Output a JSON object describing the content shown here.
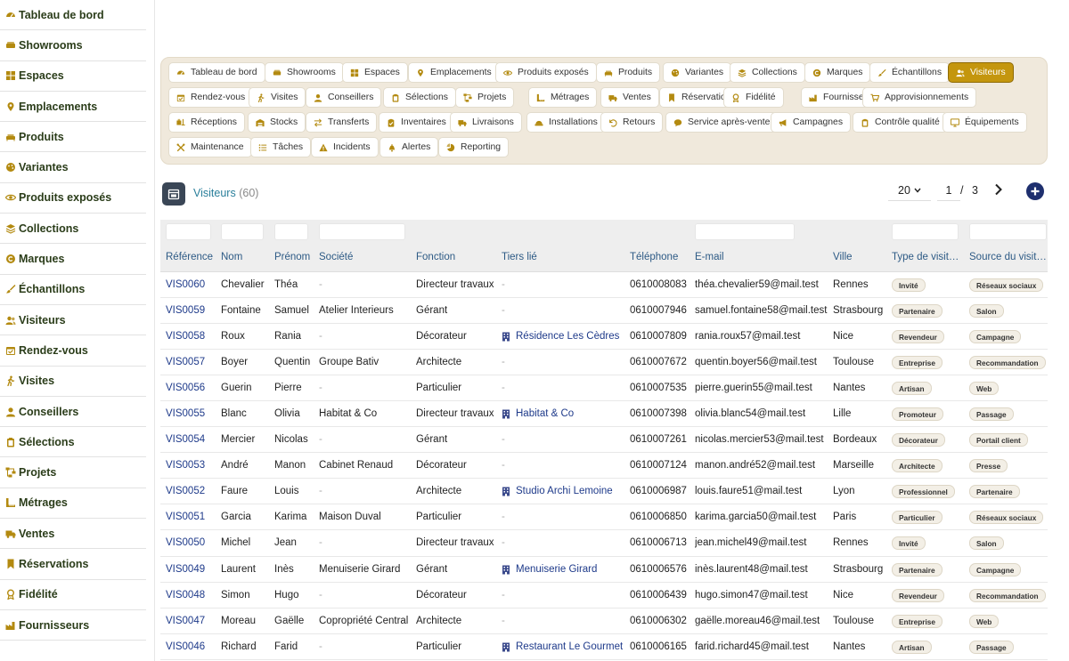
{
  "sidebar": {
    "items": [
      {
        "label": "Tableau de bord",
        "icon": "dashboard-icon"
      },
      {
        "label": "Showrooms",
        "icon": "sofa-icon"
      },
      {
        "label": "Espaces",
        "icon": "grid-icon"
      },
      {
        "label": "Emplacements",
        "icon": "pin-icon"
      },
      {
        "label": "Produits",
        "icon": "couch-icon"
      },
      {
        "label": "Variantes",
        "icon": "palette-icon"
      },
      {
        "label": "Produits exposés",
        "icon": "eye-icon"
      },
      {
        "label": "Collections",
        "icon": "layers-icon"
      },
      {
        "label": "Marques",
        "icon": "copyright-icon"
      },
      {
        "label": "Échantillons",
        "icon": "brush-icon"
      },
      {
        "label": "Visiteurs",
        "icon": "users-icon"
      },
      {
        "label": "Rendez-vous",
        "icon": "calendar-icon"
      },
      {
        "label": "Visites",
        "icon": "walk-icon"
      },
      {
        "label": "Conseillers",
        "icon": "user-icon"
      },
      {
        "label": "Sélections",
        "icon": "clipboard-icon"
      },
      {
        "label": "Projets",
        "icon": "diagram-icon"
      },
      {
        "label": "Métrages",
        "icon": "ruler-icon"
      },
      {
        "label": "Ventes",
        "icon": "truck-icon"
      },
      {
        "label": "Réservations",
        "icon": "bookmark-icon"
      },
      {
        "label": "Fidélité",
        "icon": "award-icon"
      },
      {
        "label": "Fournisseurs",
        "icon": "factory-icon"
      }
    ]
  },
  "nav": {
    "rows": [
      [
        {
          "label": "Tableau de bord",
          "icon": "dashboard-icon"
        },
        {
          "label": "Showrooms",
          "icon": "sofa-icon"
        },
        {
          "label": "Espaces",
          "icon": "grid-icon"
        },
        {
          "label": "Emplacements",
          "icon": "pin-icon"
        },
        {
          "label": "Produits exposés",
          "icon": "eye-icon"
        },
        {
          "label": "Produits",
          "icon": "couch-icon"
        },
        {
          "label": "Variantes",
          "icon": "palette-icon"
        },
        {
          "label": "Collections",
          "icon": "layers-icon"
        },
        {
          "label": "Marques",
          "icon": "copyright-icon"
        },
        {
          "label": "Échantillons",
          "icon": "brush-icon"
        },
        {
          "label": "Visiteurs",
          "icon": "users-icon",
          "active": true
        }
      ],
      [
        {
          "label": "Rendez-vous",
          "icon": "calendar-icon"
        },
        {
          "label": "Visites",
          "icon": "walk-icon"
        },
        {
          "label": "Conseillers",
          "icon": "user-icon"
        },
        {
          "label": "Sélections",
          "icon": "clipboard-icon"
        },
        {
          "label": "Projets",
          "icon": "diagram-icon"
        },
        {
          "label": "Métrages",
          "icon": "ruler-icon"
        },
        {
          "label": "Ventes",
          "icon": "truck-icon"
        },
        {
          "label": "Réservations",
          "icon": "bookmark-icon"
        },
        {
          "label": "Fidélité",
          "icon": "award-icon"
        },
        {
          "label": "Fournisseurs",
          "icon": "factory-icon"
        },
        {
          "label": "Approvisionnements",
          "icon": "cart-icon"
        }
      ],
      [
        {
          "label": "Réceptions",
          "icon": "loading-icon"
        },
        {
          "label": "Stocks",
          "icon": "warehouse-icon"
        },
        {
          "label": "Transferts",
          "icon": "swap-icon"
        },
        {
          "label": "Inventaires",
          "icon": "clipboard-check-icon"
        },
        {
          "label": "Livraisons",
          "icon": "truck-icon"
        },
        {
          "label": "Installations",
          "icon": "hardhat-icon"
        },
        {
          "label": "Retours",
          "icon": "undo-icon"
        },
        {
          "label": "Service après-vente",
          "icon": "chat-icon"
        },
        {
          "label": "Campagnes",
          "icon": "megaphone-icon"
        },
        {
          "label": "Contrôle qualité",
          "icon": "clipboard-icon"
        },
        {
          "label": "Équipements",
          "icon": "monitor-icon"
        }
      ],
      [
        {
          "label": "Maintenance",
          "icon": "tools-icon"
        },
        {
          "label": "Tâches",
          "icon": "list-icon"
        },
        {
          "label": "Incidents",
          "icon": "warning-icon"
        },
        {
          "label": "Alertes",
          "icon": "bell-icon"
        },
        {
          "label": "Reporting",
          "icon": "pie-icon"
        }
      ]
    ]
  },
  "header": {
    "title": "Visiteurs",
    "count": "(60)",
    "per_page": "20",
    "page": "1",
    "page_sep": "/",
    "total_pages": "3"
  },
  "table": {
    "columns": [
      "Référence",
      "Nom",
      "Prénom",
      "Société",
      "Fonction",
      "Tiers lié",
      "Téléphone",
      "E-mail",
      "Ville",
      "Type de visit…",
      "Source du visit…"
    ],
    "rows": [
      {
        "ref": "VIS0060",
        "nom": "Chevalier",
        "prenom": "Théa",
        "societe": "-",
        "fonction": "Directeur travaux",
        "tiers": "-",
        "tel": "0610008083",
        "email": "théa.chevalier59@mail.test",
        "ville": "Rennes",
        "type": "Invité",
        "source": "Réseaux sociaux"
      },
      {
        "ref": "VIS0059",
        "nom": "Fontaine",
        "prenom": "Samuel",
        "societe": "Atelier Interieurs",
        "fonction": "Gérant",
        "tiers": "-",
        "tel": "0610007946",
        "email": "samuel.fontaine58@mail.test",
        "ville": "Strasbourg",
        "type": "Partenaire",
        "source": "Salon"
      },
      {
        "ref": "VIS0058",
        "nom": "Roux",
        "prenom": "Rania",
        "societe": "-",
        "fonction": "Décorateur",
        "tiers": "Résidence Les Cèdres",
        "tel": "0610007809",
        "email": "rania.roux57@mail.test",
        "ville": "Nice",
        "type": "Revendeur",
        "source": "Campagne"
      },
      {
        "ref": "VIS0057",
        "nom": "Boyer",
        "prenom": "Quentin",
        "societe": "Groupe Bativ",
        "fonction": "Architecte",
        "tiers": "-",
        "tel": "0610007672",
        "email": "quentin.boyer56@mail.test",
        "ville": "Toulouse",
        "type": "Entreprise",
        "source": "Recommandation"
      },
      {
        "ref": "VIS0056",
        "nom": "Guerin",
        "prenom": "Pierre",
        "societe": "-",
        "fonction": "Particulier",
        "tiers": "-",
        "tel": "0610007535",
        "email": "pierre.guerin55@mail.test",
        "ville": "Nantes",
        "type": "Artisan",
        "source": "Web"
      },
      {
        "ref": "VIS0055",
        "nom": "Blanc",
        "prenom": "Olivia",
        "societe": "Habitat & Co",
        "fonction": "Directeur travaux",
        "tiers": "Habitat & Co",
        "tel": "0610007398",
        "email": "olivia.blanc54@mail.test",
        "ville": "Lille",
        "type": "Promoteur",
        "source": "Passage"
      },
      {
        "ref": "VIS0054",
        "nom": "Mercier",
        "prenom": "Nicolas",
        "societe": "-",
        "fonction": "Gérant",
        "tiers": "-",
        "tel": "0610007261",
        "email": "nicolas.mercier53@mail.test",
        "ville": "Bordeaux",
        "type": "Décorateur",
        "source": "Portail client"
      },
      {
        "ref": "VIS0053",
        "nom": "André",
        "prenom": "Manon",
        "societe": "Cabinet Renaud",
        "fonction": "Décorateur",
        "tiers": "-",
        "tel": "0610007124",
        "email": "manon.andré52@mail.test",
        "ville": "Marseille",
        "type": "Architecte",
        "source": "Presse"
      },
      {
        "ref": "VIS0052",
        "nom": "Faure",
        "prenom": "Louis",
        "societe": "-",
        "fonction": "Architecte",
        "tiers": "Studio Archi Lemoine",
        "tel": "0610006987",
        "email": "louis.faure51@mail.test",
        "ville": "Lyon",
        "type": "Professionnel",
        "source": "Partenaire"
      },
      {
        "ref": "VIS0051",
        "nom": "Garcia",
        "prenom": "Karima",
        "societe": "Maison Duval",
        "fonction": "Particulier",
        "tiers": "-",
        "tel": "0610006850",
        "email": "karima.garcia50@mail.test",
        "ville": "Paris",
        "type": "Particulier",
        "source": "Réseaux sociaux"
      },
      {
        "ref": "VIS0050",
        "nom": "Michel",
        "prenom": "Jean",
        "societe": "-",
        "fonction": "Directeur travaux",
        "tiers": "-",
        "tel": "0610006713",
        "email": "jean.michel49@mail.test",
        "ville": "Rennes",
        "type": "Invité",
        "source": "Salon"
      },
      {
        "ref": "VIS0049",
        "nom": "Laurent",
        "prenom": "Inès",
        "societe": "Menuiserie Girard",
        "fonction": "Gérant",
        "tiers": "Menuiserie Girard",
        "tel": "0610006576",
        "email": "inès.laurent48@mail.test",
        "ville": "Strasbourg",
        "type": "Partenaire",
        "source": "Campagne"
      },
      {
        "ref": "VIS0048",
        "nom": "Simon",
        "prenom": "Hugo",
        "societe": "-",
        "fonction": "Décorateur",
        "tiers": "-",
        "tel": "0610006439",
        "email": "hugo.simon47@mail.test",
        "ville": "Nice",
        "type": "Revendeur",
        "source": "Recommandation"
      },
      {
        "ref": "VIS0047",
        "nom": "Moreau",
        "prenom": "Gaëlle",
        "societe": "Copropriété Central",
        "fonction": "Architecte",
        "tiers": "-",
        "tel": "0610006302",
        "email": "gaëlle.moreau46@mail.test",
        "ville": "Toulouse",
        "type": "Entreprise",
        "source": "Web"
      },
      {
        "ref": "VIS0046",
        "nom": "Richard",
        "prenom": "Farid",
        "societe": "-",
        "fonction": "Particulier",
        "tiers": "Restaurant Le Gourmet",
        "tel": "0610006165",
        "email": "farid.richard45@mail.test",
        "ville": "Nantes",
        "type": "Artisan",
        "source": "Passage"
      }
    ]
  },
  "colors": {
    "accent": "#c4960e",
    "title": "#2a7f9b",
    "link": "#1e3a8a",
    "icon": "#b38a10",
    "add_button": "#1e2f6e"
  }
}
